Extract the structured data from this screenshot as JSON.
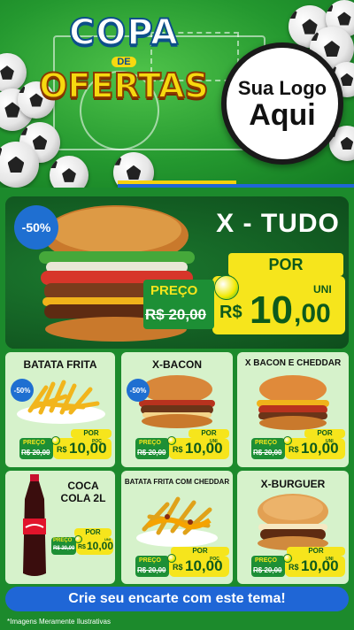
{
  "header": {
    "title_line1": "COPA",
    "title_de": "DE",
    "title_line2": "OFERTAS",
    "logo_line1": "Sua Logo",
    "logo_line2": "Aqui"
  },
  "hero": {
    "discount": "-50%",
    "name": "X - TUDO",
    "por_label": "POR",
    "uni_label": "UNI",
    "preco_label": "PREÇO",
    "old_price": "R$ 20,00",
    "currency": "R$",
    "new_price_int": "10",
    "new_price_dec": ",00"
  },
  "products": [
    {
      "name": "BATATA FRITA",
      "discount": "-50%",
      "preco_label": "PREÇO",
      "old_price": "R$ 20,00",
      "por_label": "POR",
      "unit": "POÇ",
      "currency": "R$",
      "new_price": "10,00"
    },
    {
      "name": "X-BACON",
      "discount": "-50%",
      "preco_label": "PREÇO",
      "old_price": "R$ 20,00",
      "por_label": "POR",
      "unit": "UNI",
      "currency": "R$",
      "new_price": "10,00"
    },
    {
      "name": "X BACON E CHEDDAR",
      "discount": "",
      "preco_label": "PREÇO",
      "old_price": "R$ 20,00",
      "por_label": "POR",
      "unit": "UNI",
      "currency": "R$",
      "new_price": "10,00"
    },
    {
      "name_line1": "COCA",
      "name_line2": "COLA 2L",
      "preco_label": "PREÇO",
      "old_price": "R$ 20,00",
      "por_label": "POR",
      "unit": "UNI",
      "currency": "R$",
      "new_price": "10,00"
    },
    {
      "name": "BATATA FRITA COM CHEDDAR",
      "preco_label": "PREÇO",
      "old_price": "R$ 20,00",
      "por_label": "POR",
      "unit": "POÇ",
      "currency": "R$",
      "new_price": "10,00"
    },
    {
      "name": "X-BURGUER",
      "preco_label": "PREÇO",
      "old_price": "R$ 20,00",
      "por_label": "POR",
      "unit": "UNI",
      "currency": "R$",
      "new_price": "10,00"
    }
  ],
  "cta": "Crie seu encarte com este tema!",
  "disclaimer": "*Imagens Meramente Ilustrativas",
  "colors": {
    "field_green": "#24982f",
    "dark_green": "#0e4d1c",
    "yellow": "#f6e51c",
    "blue": "#1f66d6",
    "card_bg": "#d6f2cb"
  }
}
